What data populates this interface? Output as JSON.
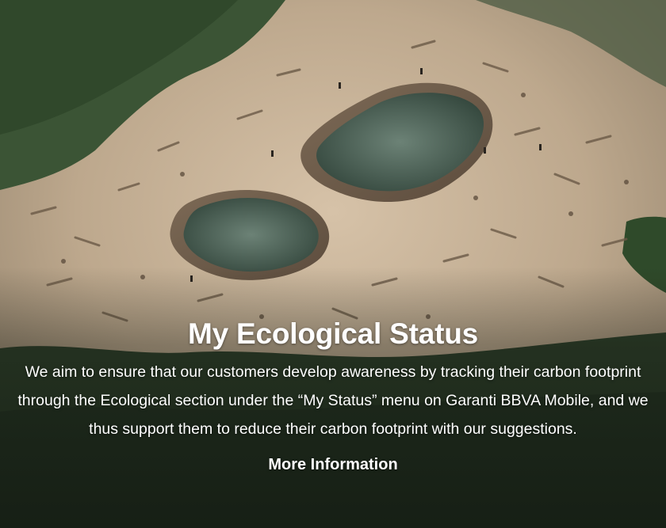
{
  "hero": {
    "image": "deforested-land-footprint-photo",
    "title": "My Ecological Status",
    "description": "We aim to ensure that our customers develop awareness by tracking their carbon footprint through the Ecological section under the “My Status” menu on Garanti BBVA Mobile, and we thus support them to reduce their carbon footprint with our suggestions.",
    "link_label": "More Information"
  },
  "colors": {
    "text": "#ffffff",
    "ground": "#c9b49c",
    "forest": "#2f4a2c",
    "water": "#3f5a4c"
  }
}
